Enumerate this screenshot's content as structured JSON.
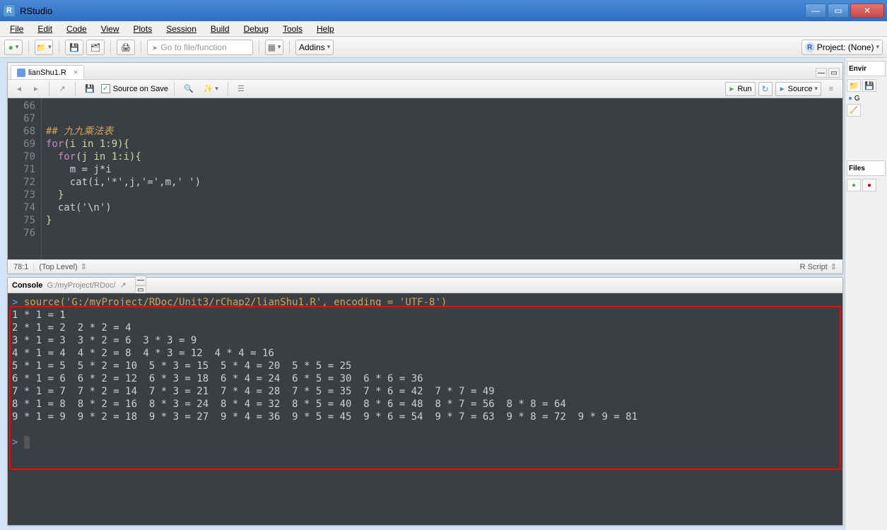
{
  "window": {
    "title": "RStudio"
  },
  "menubar": [
    "File",
    "Edit",
    "Code",
    "View",
    "Plots",
    "Session",
    "Build",
    "Debug",
    "Tools",
    "Help"
  ],
  "toolbar": {
    "search_placeholder": "Go to file/function",
    "addins_label": "Addins",
    "project_label": "Project: (None)"
  },
  "editor": {
    "tab_name": "lianShu1.R",
    "source_on_save_label": "Source on Save",
    "run_label": "Run",
    "source_label": "Source",
    "gutter": [
      "66",
      "67",
      "68",
      "69",
      "70",
      "71",
      "72",
      "73",
      "74",
      "75",
      "76"
    ],
    "lines": {
      "l66": "",
      "l67": "",
      "l68_comment": "## 九九乘法表",
      "l69_for": "for",
      "l69_rest": "(i in 1:9){",
      "l70_indent": "  ",
      "l70_for": "for",
      "l70_rest": "(j in 1:i){",
      "l71": "    m = j*i",
      "l72": "    cat(i,'*',j,'=',m,' ')",
      "l73": "  }",
      "l74": "  cat('\\n')",
      "l75": "}",
      "l76": ""
    },
    "status_pos": "78:1",
    "status_scope": "(Top Level)",
    "status_type": "R Script"
  },
  "console": {
    "title": "Console",
    "path": "G:/myProject/RDoc/",
    "cmd": "source('G:/myProject/RDoc/Unit3/rChap2/lianShu1.R', encoding = 'UTF-8')",
    "output": [
      "1 * 1 = 1  ",
      "2 * 1 = 2  2 * 2 = 4  ",
      "3 * 1 = 3  3 * 2 = 6  3 * 3 = 9  ",
      "4 * 1 = 4  4 * 2 = 8  4 * 3 = 12  4 * 4 = 16  ",
      "5 * 1 = 5  5 * 2 = 10  5 * 3 = 15  5 * 4 = 20  5 * 5 = 25  ",
      "6 * 1 = 6  6 * 2 = 12  6 * 3 = 18  6 * 4 = 24  6 * 5 = 30  6 * 6 = 36  ",
      "7 * 1 = 7  7 * 2 = 14  7 * 3 = 21  7 * 4 = 28  7 * 5 = 35  7 * 6 = 42  7 * 7 = 49  ",
      "8 * 1 = 8  8 * 2 = 16  8 * 3 = 24  8 * 4 = 32  8 * 5 = 40  8 * 6 = 48  8 * 7 = 56  8 * 8 = 64  ",
      "9 * 1 = 9  9 * 2 = 18  9 * 3 = 27  9 * 4 = 36  9 * 5 = 45  9 * 6 = 54  9 * 7 = 63  9 * 8 = 72  9 * 9 = 81  "
    ],
    "prompt": ">"
  },
  "right_panel": {
    "tab1": "Envir",
    "tab2": "G",
    "tab3": "Files"
  }
}
